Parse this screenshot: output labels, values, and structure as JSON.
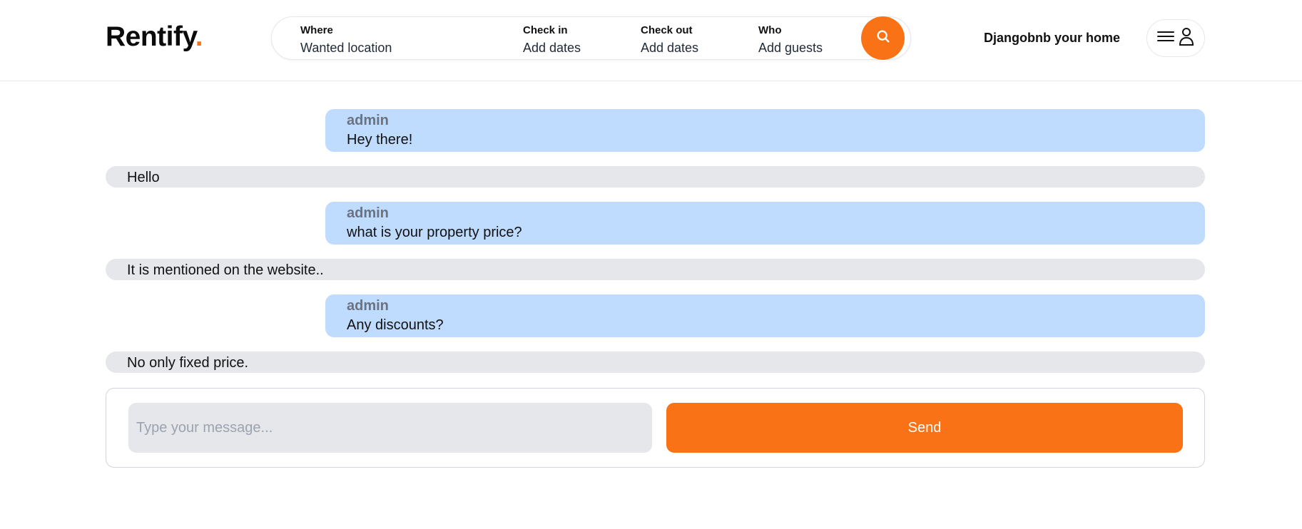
{
  "brand": {
    "name": "Rentify",
    "dot": ".",
    "accent_color": "#f97316"
  },
  "search": {
    "where": {
      "label": "Where",
      "value": "Wanted location"
    },
    "check_in": {
      "label": "Check in",
      "value": "Add dates"
    },
    "check_out": {
      "label": "Check out",
      "value": "Add dates"
    },
    "who": {
      "label": "Who",
      "value": "Add guests"
    },
    "button_icon": "search-icon"
  },
  "nav": {
    "host_link": "Djangobnb your home",
    "menu_icon": "hamburger-icon",
    "user_icon": "user-icon"
  },
  "conversation": {
    "messages": [
      {
        "sender": "admin",
        "text": "Hey there!",
        "own": true
      },
      {
        "sender": "",
        "text": "Hello",
        "own": false
      },
      {
        "sender": "admin",
        "text": "what is your property price?",
        "own": true
      },
      {
        "sender": "",
        "text": "It is mentioned on the website..",
        "own": false
      },
      {
        "sender": "admin",
        "text": "Any discounts?",
        "own": true
      },
      {
        "sender": "",
        "text": "No only fixed price.",
        "own": false
      }
    ]
  },
  "composer": {
    "placeholder": "Type your message...",
    "value": "",
    "send_label": "Send"
  },
  "colors": {
    "sent_bubble": "#bfdbfe",
    "received_bubble": "#e5e7eb",
    "sender_name": "#6b7280",
    "accent": "#f97316"
  }
}
